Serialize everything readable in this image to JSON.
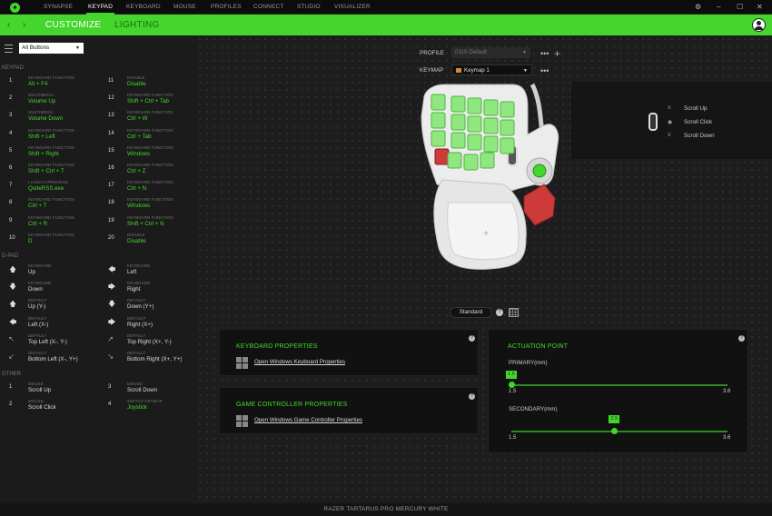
{
  "app": {
    "logo_icon": "razer-snake-icon",
    "accent": "#44d62c"
  },
  "topnav": [
    {
      "label": "SYNAPSE",
      "active": false
    },
    {
      "label": "KEYPAD",
      "active": true
    },
    {
      "label": "KEYBOARD",
      "active": false
    },
    {
      "label": "MOUSE",
      "active": false
    },
    {
      "label": "PROFILES",
      "active": false
    },
    {
      "label": "CONNECT",
      "active": false
    },
    {
      "label": "STUDIO",
      "active": false
    },
    {
      "label": "VISUALIZER",
      "active": false
    }
  ],
  "window_controls": {
    "settings": "⚙",
    "minimize": "–",
    "maximize": "☐",
    "close": "✕"
  },
  "subnav": {
    "back": "‹",
    "forward": "›",
    "tabs": [
      {
        "label": "CUSTOMIZE",
        "active": true
      },
      {
        "label": "LIGHTING",
        "active": false
      }
    ]
  },
  "sidebar": {
    "filter_value": "All Buttons",
    "sections": {
      "keypad": "KEYPAD",
      "dpad": "D-PAD",
      "other": "OTHER"
    },
    "keypad": [
      {
        "num": "1",
        "type": "KEYBOARD FUNCTION",
        "value": "Alt + F4",
        "green": true
      },
      {
        "num": "11",
        "type": "DISABLE",
        "value": "Disable",
        "green": true
      },
      {
        "num": "2",
        "type": "MULTIMEDIA",
        "value": "Volume Up",
        "green": true
      },
      {
        "num": "12",
        "type": "KEYBOARD FUNCTION",
        "value": "Shift + Ctrl + Tab",
        "green": true
      },
      {
        "num": "3",
        "type": "MULTIMEDIA",
        "value": "Volume Down",
        "green": true
      },
      {
        "num": "13",
        "type": "KEYBOARD FUNCTION",
        "value": "Ctrl + W",
        "green": true
      },
      {
        "num": "4",
        "type": "KEYBOARD FUNCTION",
        "value": "Shift + Left",
        "green": true
      },
      {
        "num": "14",
        "type": "KEYBOARD FUNCTION",
        "value": "Ctrl + Tab",
        "green": true
      },
      {
        "num": "5",
        "type": "KEYBOARD FUNCTION",
        "value": "Shift + Right",
        "green": true
      },
      {
        "num": "15",
        "type": "KEYBOARD FUNCTION",
        "value": "Windows",
        "green": true
      },
      {
        "num": "6",
        "type": "KEYBOARD FUNCTION",
        "value": "Shift + Ctrl + T",
        "green": true
      },
      {
        "num": "16",
        "type": "KEYBOARD FUNCTION",
        "value": "Ctrl + Z",
        "green": true
      },
      {
        "num": "7",
        "type": "LAUNCH PROGRAM",
        "value": "QuiteRSS.exe",
        "green": true
      },
      {
        "num": "17",
        "type": "KEYBOARD FUNCTION",
        "value": "Ctrl + N",
        "green": true
      },
      {
        "num": "8",
        "type": "KEYBOARD FUNCTION",
        "value": "Ctrl + T",
        "green": true
      },
      {
        "num": "18",
        "type": "KEYBOARD FUNCTION",
        "value": "Windows",
        "green": true
      },
      {
        "num": "9",
        "type": "KEYBOARD FUNCTION",
        "value": "Ctrl + R",
        "green": true
      },
      {
        "num": "19",
        "type": "KEYBOARD FUNCTION",
        "value": "Shift + Ctrl + N",
        "green": true
      },
      {
        "num": "10",
        "type": "KEYBOARD FUNCTION",
        "value": "D",
        "green": true
      },
      {
        "num": "20",
        "type": "DISABLE",
        "value": "Disable",
        "green": true
      }
    ],
    "dpad": [
      {
        "icon": "🡅",
        "icon_name": "arrow-up-icon",
        "type": "KEYBOARD",
        "value": "Up",
        "green": false
      },
      {
        "icon": "🡄",
        "icon_name": "arrow-left-icon",
        "type": "KEYBOARD",
        "value": "Left",
        "green": false
      },
      {
        "icon": "🡇",
        "icon_name": "arrow-down-icon",
        "type": "KEYBOARD",
        "value": "Down",
        "green": false
      },
      {
        "icon": "🡆",
        "icon_name": "arrow-right-icon",
        "type": "KEYBOARD",
        "value": "Right",
        "green": false
      },
      {
        "icon": "🡅",
        "icon_name": "arrow-up-icon",
        "type": "DEFAULT",
        "value": "Up (Y-)",
        "green": false
      },
      {
        "icon": "🡇",
        "icon_name": "arrow-down-icon",
        "type": "DEFAULT",
        "value": "Down (Y+)",
        "green": false
      },
      {
        "icon": "🡄",
        "icon_name": "arrow-left-icon",
        "type": "DEFAULT",
        "value": "Left (X-)",
        "green": false
      },
      {
        "icon": "🡆",
        "icon_name": "arrow-right-icon",
        "type": "DEFAULT",
        "value": "Right (X+)",
        "green": false
      },
      {
        "icon": "🡔",
        "icon_name": "arrow-up-left-icon",
        "type": "DEFAULT",
        "value": "Top Left (X-, Y-)",
        "green": false
      },
      {
        "icon": "🡕",
        "icon_name": "arrow-up-right-icon",
        "type": "DEFAULT",
        "value": "Top Right (X+, Y-)",
        "green": false
      },
      {
        "icon": "🡗",
        "icon_name": "arrow-down-left-icon",
        "type": "DEFAULT",
        "value": "Bottom Left (X-, Y+)",
        "green": false
      },
      {
        "icon": "🡖",
        "icon_name": "arrow-down-right-icon",
        "type": "DEFAULT",
        "value": "Bottom Right (X+, Y+)",
        "green": false
      }
    ],
    "other": [
      {
        "num": "1",
        "type": "MOUSE",
        "value": "Scroll Up",
        "green": false
      },
      {
        "num": "3",
        "type": "MOUSE",
        "value": "Scroll Down",
        "green": false
      },
      {
        "num": "2",
        "type": "MOUSE",
        "value": "Scroll Click",
        "green": false
      },
      {
        "num": "4",
        "type": "SWITCH KEYMAP",
        "value": "Joystick",
        "green": true
      }
    ]
  },
  "main": {
    "profile_label": "PROFILE",
    "profile_value": "0110-Default",
    "keymap_label": "KEYMAP",
    "keymap_value": "Keymap 1",
    "more": "•••",
    "add": "+",
    "wheel_panel": [
      {
        "icon": "≡",
        "label": "Scroll Up"
      },
      {
        "icon": "◉",
        "label": "Scroll Click"
      },
      {
        "icon": "≡",
        "label": "Scroll Down"
      }
    ],
    "view_mode": "Standard",
    "help": "?",
    "keyboard_properties": {
      "title": "KEYBOARD PROPERTIES",
      "link": "Open Windows Keyboard Properties"
    },
    "controller_properties": {
      "title": "GAME CONTROLLER PROPERTIES",
      "link": "Open Windows Game Controller Properties"
    },
    "actuation": {
      "title": "ACTUATION POINT",
      "primary_label": "PRIMARY(mm)",
      "primary_value": 1.5,
      "primary_value_text": "1.5",
      "secondary_label": "SECONDARY(mm)",
      "secondary_value": 2.5,
      "secondary_value_text": "2.5",
      "min": 1.5,
      "max": 3.6,
      "min_text": "1.5",
      "max_text": "3.6"
    }
  },
  "status": {
    "device_name": "RAZER TARTARUS PRO MERCURY WHITE"
  }
}
